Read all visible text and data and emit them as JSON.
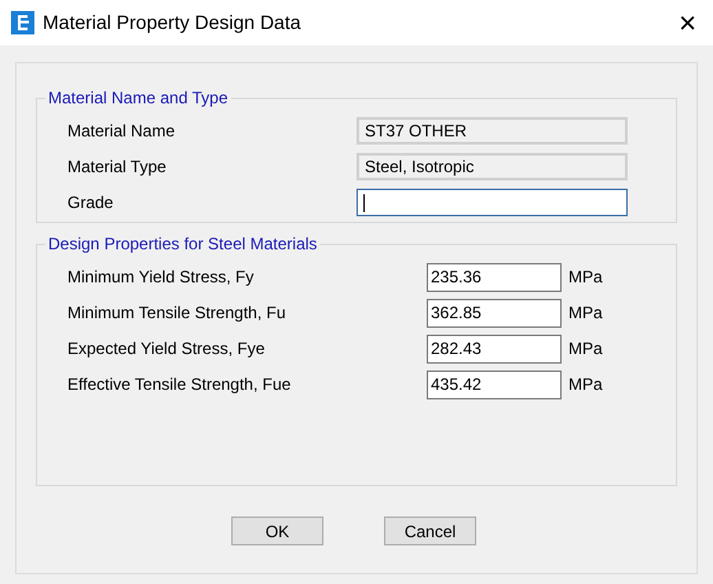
{
  "window": {
    "title": "Material Property Design Data",
    "close": "×"
  },
  "name_group": {
    "title": "Material Name and Type",
    "fields": [
      {
        "label": "Material Name",
        "value": "ST37 OTHER",
        "readonly": true,
        "focused": false
      },
      {
        "label": "Material Type",
        "value": "Steel, Isotropic",
        "readonly": true,
        "focused": false
      },
      {
        "label": "Grade",
        "readonly": false,
        "focused": true
      }
    ]
  },
  "design_group": {
    "title": "Design Properties for Steel Materials",
    "fields": [
      {
        "label": "Minimum Yield Stress, Fy",
        "value": "235.36",
        "unit": "MPa"
      },
      {
        "label": "Minimum Tensile Strength, Fu",
        "value": "362.85",
        "unit": "MPa"
      },
      {
        "label": "Expected Yield Stress, Fye",
        "value": "282.43",
        "unit": "MPa"
      },
      {
        "label": "Effective Tensile Strength, Fue",
        "value": "435.42",
        "unit": "MPa"
      }
    ]
  },
  "buttons": [
    "OK",
    "Cancel"
  ]
}
